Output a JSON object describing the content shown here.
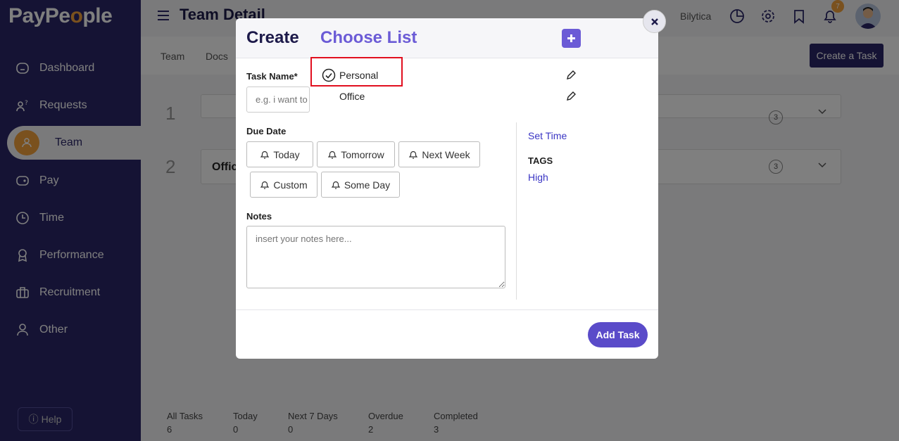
{
  "sidebar": {
    "logo": "PayPeople",
    "items": [
      {
        "label": "Dashboard",
        "icon": "home-icon"
      },
      {
        "label": "Requests",
        "icon": "requests-icon"
      },
      {
        "label": "Team",
        "icon": "team-icon"
      },
      {
        "label": "Pay",
        "icon": "wallet-icon"
      },
      {
        "label": "Time",
        "icon": "clock-icon"
      },
      {
        "label": "Performance",
        "icon": "award-icon"
      },
      {
        "label": "Recruitment",
        "icon": "briefcase-icon"
      },
      {
        "label": "Other",
        "icon": "user-icon"
      }
    ],
    "help_label": "Help"
  },
  "header": {
    "title": "Team Detail",
    "company": "Bilytica",
    "notification_count": "7"
  },
  "subnav": {
    "tabs": [
      "Team",
      "Docs"
    ],
    "create_task_label": "Create a Task"
  },
  "lists": [
    {
      "index": "1",
      "label": "",
      "count": "3"
    },
    {
      "index": "2",
      "label": "Offic",
      "count": "3"
    }
  ],
  "stats": [
    {
      "label": "All Tasks",
      "value": "6"
    },
    {
      "label": "Today",
      "value": "0"
    },
    {
      "label": "Next 7 Days",
      "value": "0"
    },
    {
      "label": "Overdue",
      "value": "2"
    },
    {
      "label": "Completed",
      "value": "3"
    }
  ],
  "modal": {
    "create_label": "Create",
    "choose_list_label": "Choose List",
    "task_name_label": "Task Name*",
    "task_name_placeholder": "e.g. i want to",
    "list_options": [
      "Personal",
      "Office"
    ],
    "due_date_label": "Due Date",
    "due_options": [
      "Today",
      "Tomorrow",
      "Next Week",
      "Custom",
      "Some Day"
    ],
    "notes_label": "Notes",
    "notes_placeholder": "insert your notes here...",
    "time_link": "Set Time",
    "tags_label": "TAGS",
    "tag_value": "High",
    "add_task_label": "Add Task"
  },
  "colors": {
    "sidebar": "#2b2768",
    "accent": "#6b5bd6",
    "highlight": "#e10f1f",
    "orange": "#f4a23c"
  }
}
